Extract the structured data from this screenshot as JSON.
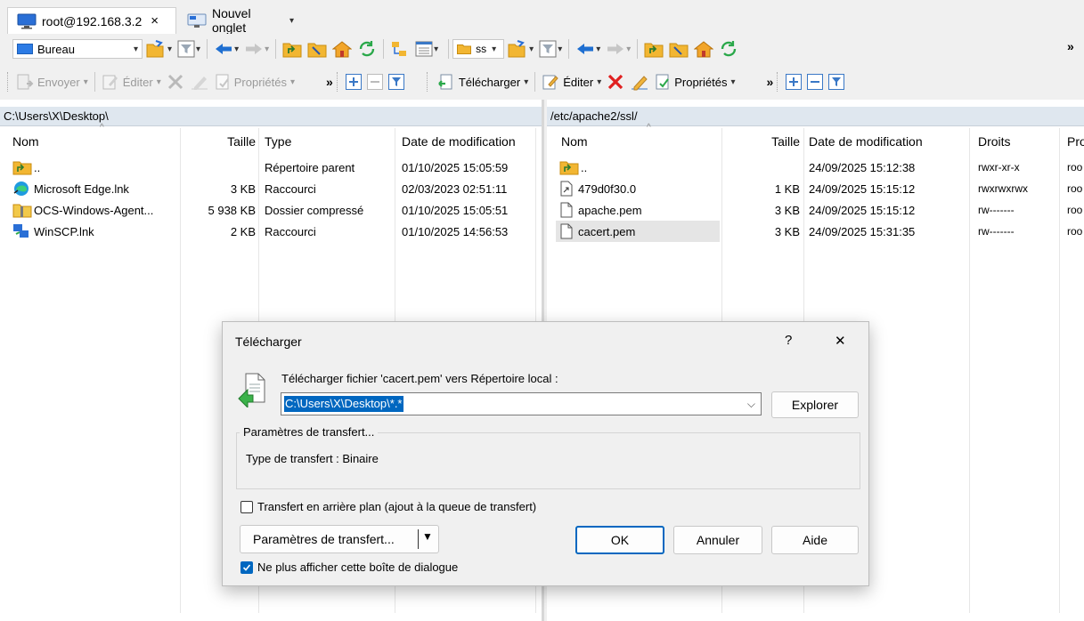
{
  "tabs": [
    {
      "label": "root@192.168.3.2",
      "close": "×"
    },
    {
      "label": "Nouvel onglet",
      "caret": "▾"
    }
  ],
  "left_toolbar": {
    "location_combo": "Bureau"
  },
  "right_toolbar": {
    "location_combo": "ss"
  },
  "left_actions": {
    "send": "Envoyer",
    "edit": "Éditer",
    "properties": "Propriétés"
  },
  "right_actions": {
    "download": "Télécharger",
    "edit": "Éditer",
    "properties": "Propriétés"
  },
  "overflow": "»",
  "left_panel": {
    "path": "C:\\Users\\X\\Desktop\\",
    "columns": [
      "Nom",
      "Taille",
      "Type",
      "Date de modification"
    ],
    "rows": [
      {
        "name": "..",
        "size": "",
        "type": "Répertoire parent",
        "date": "01/10/2025 15:05:59",
        "icon": "parent-folder-icon"
      },
      {
        "name": "Microsoft Edge.lnk",
        "size": "3 KB",
        "type": "Raccourci",
        "date": "02/03/2023 02:51:11",
        "icon": "edge-icon"
      },
      {
        "name": "OCS-Windows-Agent...",
        "size": "5 938 KB",
        "type": "Dossier compressé",
        "date": "01/10/2025 15:05:51",
        "icon": "zip-folder-icon"
      },
      {
        "name": "WinSCP.lnk",
        "size": "2 KB",
        "type": "Raccourci",
        "date": "01/10/2025 14:56:53",
        "icon": "winscp-icon"
      }
    ]
  },
  "right_panel": {
    "path": "/etc/apache2/ssl/",
    "columns": [
      "Nom",
      "Taille",
      "Date de modification",
      "Droits",
      "Pro"
    ],
    "rows": [
      {
        "name": "..",
        "size": "",
        "date": "24/09/2025 15:12:38",
        "rights": "rwxr-xr-x",
        "owner": "roo",
        "icon": "parent-folder-icon"
      },
      {
        "name": "479d0f30.0",
        "size": "1 KB",
        "date": "24/09/2025 15:15:12",
        "rights": "rwxrwxrwx",
        "owner": "roo",
        "icon": "link-file-icon"
      },
      {
        "name": "apache.pem",
        "size": "3 KB",
        "date": "24/09/2025 15:15:12",
        "rights": "rw-------",
        "owner": "roo",
        "icon": "file-icon"
      },
      {
        "name": "cacert.pem",
        "size": "3 KB",
        "date": "24/09/2025 15:31:35",
        "rights": "rw-------",
        "owner": "roo",
        "icon": "file-icon"
      }
    ]
  },
  "dialog": {
    "title": "Télécharger",
    "help": "?",
    "close": "✕",
    "prompt": "Télécharger fichier 'cacert.pem' vers Répertoire local :",
    "target_value": "C:\\Users\\X\\Desktop\\*.*",
    "browse_label": "Explorer",
    "group_title": "Paramètres de transfert...",
    "transfer_type": "Type de transfert : Binaire",
    "background_label": "Transfert en arrière plan (ajout à la queue de transfert)",
    "background_checked": false,
    "settings_button": "Paramètres de transfert...",
    "ok": "OK",
    "cancel": "Annuler",
    "help_button": "Aide",
    "dont_show_label": "Ne plus afficher cette boîte de dialogue",
    "dont_show_checked": true
  },
  "colors": {
    "accent": "#0067c0",
    "path_bar": "#dfe7ef",
    "toolbar_bg": "#f0f0f0",
    "delete_red": "#e02020"
  }
}
